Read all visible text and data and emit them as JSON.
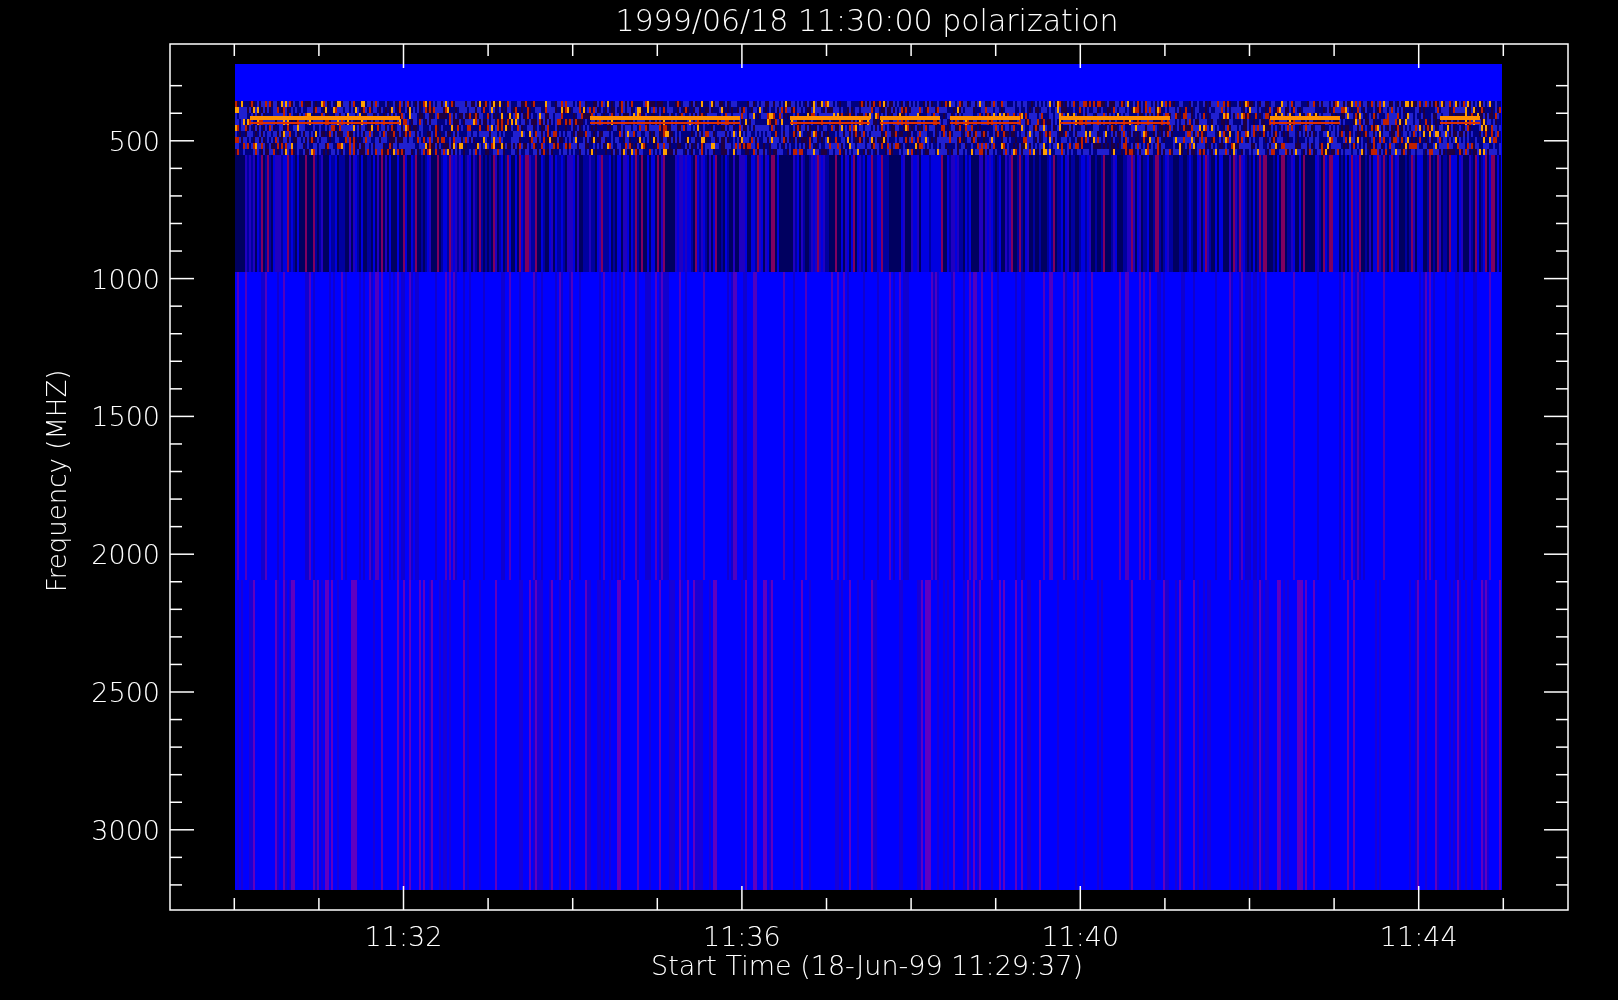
{
  "plot": {
    "title": "1999/06/18 11:30:00 polarization",
    "x_axis": {
      "label": "Start Time (18-Jun-99 11:29:37)",
      "ticks": [
        "11:32",
        "11:36",
        "11:40",
        "11:44"
      ]
    },
    "y_axis": {
      "label": "Frequency (MHZ)",
      "ticks": [
        "500",
        "1000",
        "1500",
        "2000",
        "2500",
        "3000"
      ]
    }
  }
}
